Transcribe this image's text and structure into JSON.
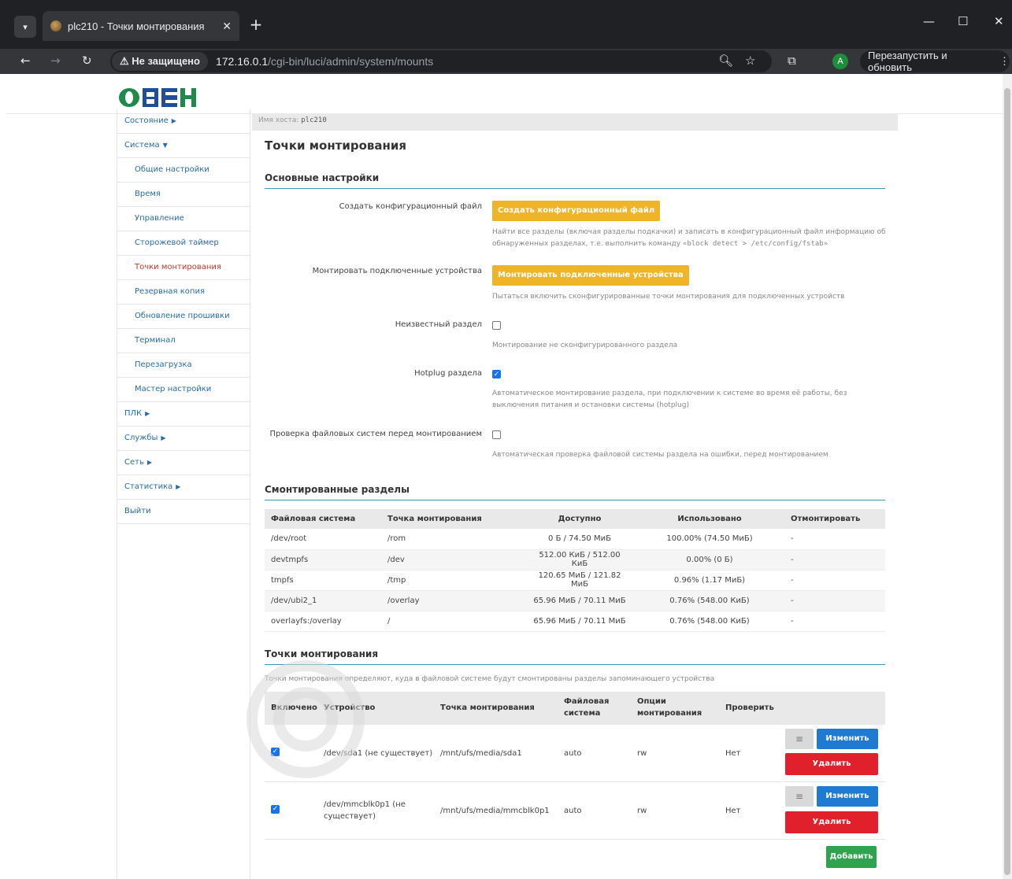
{
  "browser": {
    "tab_title": "plc210 - Точки монтирования",
    "tab_close": "✕",
    "new_tab": "+",
    "insecure_label": "⚠ Не защищено",
    "url_host": "172.16.0.1",
    "url_path": "/cgi-bin/luci/admin/system/mounts",
    "profile_initial": "A",
    "restart_label": "Перезапустить и обновить"
  },
  "logo_text": "ОВЕН",
  "sidebar": {
    "items": [
      {
        "label": "Состояние",
        "arrow": "▶",
        "level": "top"
      },
      {
        "label": "Система",
        "arrow": "▼",
        "level": "top"
      },
      {
        "label": "Общие настройки",
        "level": "sub"
      },
      {
        "label": "Время",
        "level": "sub"
      },
      {
        "label": "Управление",
        "level": "sub"
      },
      {
        "label": "Сторожевой таймер",
        "level": "sub"
      },
      {
        "label": "Точки монтирования",
        "level": "sub",
        "active": true
      },
      {
        "label": "Резервная копия",
        "level": "sub"
      },
      {
        "label": "Обновление прошивки",
        "level": "sub"
      },
      {
        "label": "Терминал",
        "level": "sub"
      },
      {
        "label": "Перезагрузка",
        "level": "sub"
      },
      {
        "label": "Мастер настройки",
        "level": "sub"
      },
      {
        "label": "ПЛК",
        "arrow": "▶",
        "level": "top"
      },
      {
        "label": "Службы",
        "arrow": "▶",
        "level": "top"
      },
      {
        "label": "Сеть",
        "arrow": "▶",
        "level": "top"
      },
      {
        "label": "Статистика",
        "arrow": "▶",
        "level": "top"
      },
      {
        "label": "Выйти",
        "level": "top"
      }
    ]
  },
  "hostbar": {
    "label": "Имя хоста:",
    "value": "plc210"
  },
  "page_title": "Точки монтирования",
  "basic": {
    "title": "Основные настройки",
    "generate_label": "Создать конфигурационный файл",
    "generate_button": "Создать конфигурационный файл",
    "generate_help": "Найти все разделы (включая разделы подкачки) и записать в конфигурационный файл информацию об обнаруженных разделах, т.е. выполнить команду",
    "generate_cmd": "«block detect > /etc/config/fstab»",
    "mount_label": "Монтировать подключенные устройства",
    "mount_button": "Монтировать подключенные устройства",
    "mount_help": "Пытаться включить сконфигурированные точки монтирования для подключенных устройств",
    "anon_label": "Неизвестный раздел",
    "anon_help": "Монтирование не сконфигурированного раздела",
    "hotplug_label": "Hotplug раздела",
    "hotplug_help": "Автоматическое монтирование раздела, при подключении к системе во время её работы, без выключения питания и остановки системы (hotplug)",
    "check_label": "Проверка файловых систем перед монтированием",
    "check_help": "Автоматическая проверка файловой системы раздела на ошибки, перед монтированием"
  },
  "mounted": {
    "title": "Смонтированные разделы",
    "headers": [
      "Файловая система",
      "Точка монтирования",
      "Доступно",
      "Использовано",
      "Отмонтировать"
    ],
    "rows": [
      [
        "/dev/root",
        "/rom",
        "0 Б / 74.50 МиБ",
        "100.00% (74.50 МиБ)",
        "-"
      ],
      [
        "devtmpfs",
        "/dev",
        "512.00 КиБ / 512.00 КиБ",
        "0.00% (0 Б)",
        "-"
      ],
      [
        "tmpfs",
        "/tmp",
        "120.65 МиБ / 121.82 МиБ",
        "0.96% (1.17 МиБ)",
        "-"
      ],
      [
        "/dev/ubi2_1",
        "/overlay",
        "65.96 МиБ / 70.11 МиБ",
        "0.76% (548.00 КиБ)",
        "-"
      ],
      [
        "overlayfs:/overlay",
        "/",
        "65.96 МиБ / 70.11 МиБ",
        "0.76% (548.00 КиБ)",
        "-"
      ]
    ]
  },
  "mountpoints": {
    "title": "Точки монтирования",
    "description": "Точки монтирования определяют, куда в файловой системе будут смонтированы разделы запоминающего устройства",
    "headers": {
      "enabled": "Включено",
      "device": "Устройство",
      "target": "Точка монтирования",
      "fs_1": "Файловая",
      "fs_2": "система",
      "opts_1": "Опции",
      "opts_2": "монтирования",
      "check": "Проверить"
    },
    "rows": [
      {
        "device_1": "/dev/sda1 (не существует)",
        "device_2": "",
        "target": "/mnt/ufs/media/sda1",
        "fs": "auto",
        "opts": "rw",
        "check": "Нет"
      },
      {
        "device_1": "/dev/mmcblk0p1 (не",
        "device_2": "существует)",
        "target": "/mnt/ufs/media/mmcblk0p1",
        "fs": "auto",
        "opts": "rw",
        "check": "Нет"
      }
    ],
    "edit_button": "Изменить",
    "delete_button": "Удалить",
    "sort_glyph": "≡",
    "add_button": "Добавить"
  },
  "colors": {
    "accent": "#3a98b9",
    "orange": "#f0b429",
    "blue": "#1e7ad3",
    "red": "#e0202a",
    "green": "#2ea44f",
    "link": "#2a6ba8",
    "active": "#c0392b"
  }
}
